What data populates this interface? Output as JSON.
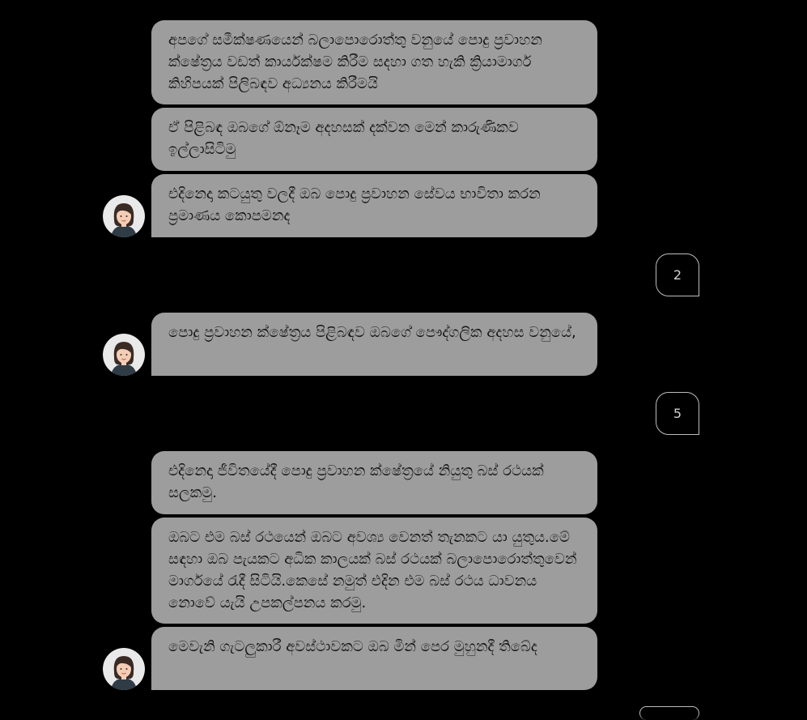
{
  "messages": {
    "group1": [
      "අපගේ සමීක්ෂණයෙන් බලාපොරොත්තු වනුයේ පොදු ප්‍රවාහන ක්ෂේත්‍රය වඩත් කාර්යක්ෂම කිරීම සදහා ගත හැකි ක්‍රියාමාර්ග කිහිපයක් පිලිබඳව අධ්‍යනය කිරීමයි",
      "ඒ පිළිබඳ ඔබගේ ඕනෑම අදහසක් දක්වන මෙන් කාරුණිකව ඉල්ලාසිටිමු",
      "එදිනෙදා කටයුතු වලදී ඔබ පොදු ප්‍රවාහන සේවය භාවිතා කරන ප්‍රමාණය කොපමනද"
    ],
    "group2": [
      "පොදු ප්‍රවාහන ක්ෂේත්‍රය පිළිබඳව ඔබගේ පෞද්ගලික අදහස වනුයේ,"
    ],
    "group3": [
      "එදිනෙදා ජීවිතයේදී පොදු ප්‍රවාහන ක්ෂේත්‍රයේ නියුතු බස් රථයක් සලකමු.",
      "ඔබට එම බස් රථයෙන් ඔබට අවශ්‍ය වෙනත් තැනකට යා යුතුය.මේ සඳහා ඔබ පැයකට අධික කාලයක් බස් රථයක් බලාපොරොත්තුවෙන් මාර්ගයේ රැදී සිටියි.කෙසේ නමුත් එදින එම බස් රථය ධාවනය නොවේ යැයි උපකල්පනය කරමු.",
      "මෙවැනි ගැටලුකාරී අවස්ථාවකට ඔබ මින් පෙර මුහුනදී තිබේද"
    ]
  },
  "replies": {
    "reply1": "2",
    "reply2": "5"
  },
  "avatar_icon": "female-avatar-icon",
  "colors": {
    "background": "#000000",
    "bubble": "#9d9d9d",
    "bubble_text": "#111111",
    "reply_border": "#bdbdbd"
  }
}
